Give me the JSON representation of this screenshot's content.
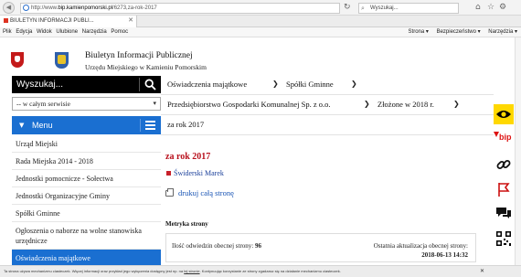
{
  "browser": {
    "url_prefix": "http://www.",
    "url_domain": "bip.kamienpomorski.pl",
    "url_path": "/6273,za-rok-2017",
    "search_placeholder": "Wyszukaj...",
    "tab_title": "BIULETYN INFORMACJI PUBLI...",
    "menu_items": [
      "Plik",
      "Edycja",
      "Widok",
      "Ulubione",
      "Narzędzia",
      "Pomoc"
    ],
    "command_items": [
      "Strona ▾",
      "Bezpieczeństwo ▾",
      "Narzędzia ▾"
    ]
  },
  "header": {
    "title": "Biuletyn Informacji Publicznej",
    "subtitle": "Urzędu Miejskiego w Kamieniu Pomorskim"
  },
  "search": {
    "placeholder": "Wyszukaj...",
    "scope": "-- w całym serwisie"
  },
  "menu": {
    "label": "Menu",
    "items": [
      "Urząd Miejski",
      "Rada Miejska 2014 - 2018",
      "Jednostki pomocnicze - Sołectwa",
      "Jednostki Organizacyjne Gminy",
      "Spółki Gminne",
      "Ogłoszenia o naborze na wolne stanowiska urzędnicze",
      "Oświadczenia majątkowe"
    ]
  },
  "breadcrumbs": [
    "Oświadczenia majątkowe",
    "Spółki Gminne",
    "Przedsiębiorstwo Gospodarki Komunalnej Sp. z o.o.",
    "Złożone w 2018 r.",
    "za rok 2017"
  ],
  "content": {
    "title": "za rok 2017",
    "person": "Świderski Marek",
    "print_label": "drukuj całą stronę"
  },
  "metrics": {
    "title": "Metryka strony",
    "views_label": "Ilość odwiedzin obecnej strony:",
    "views_value": "96",
    "updated_label": "Ostatnia aktualizacja obecnej strony:",
    "updated_value": "2018-06-13 14:32"
  },
  "dock": {
    "bip_label": "bip"
  },
  "cookie": {
    "text": "Ta strona używa mechanizmu ciasteczek. Więcej informacji oraz przykład jego wyłączenia dostępny jest np. na",
    "link": "tej stronie",
    "text2": ". Kontynuując korzystanie ze strony zgadzasz się na działanie mechanizmu ciasteczek."
  },
  "colors": {
    "accent_blue": "#1a6fd1",
    "title_red": "#b8101c",
    "contrast_yellow": "#ffd800"
  }
}
